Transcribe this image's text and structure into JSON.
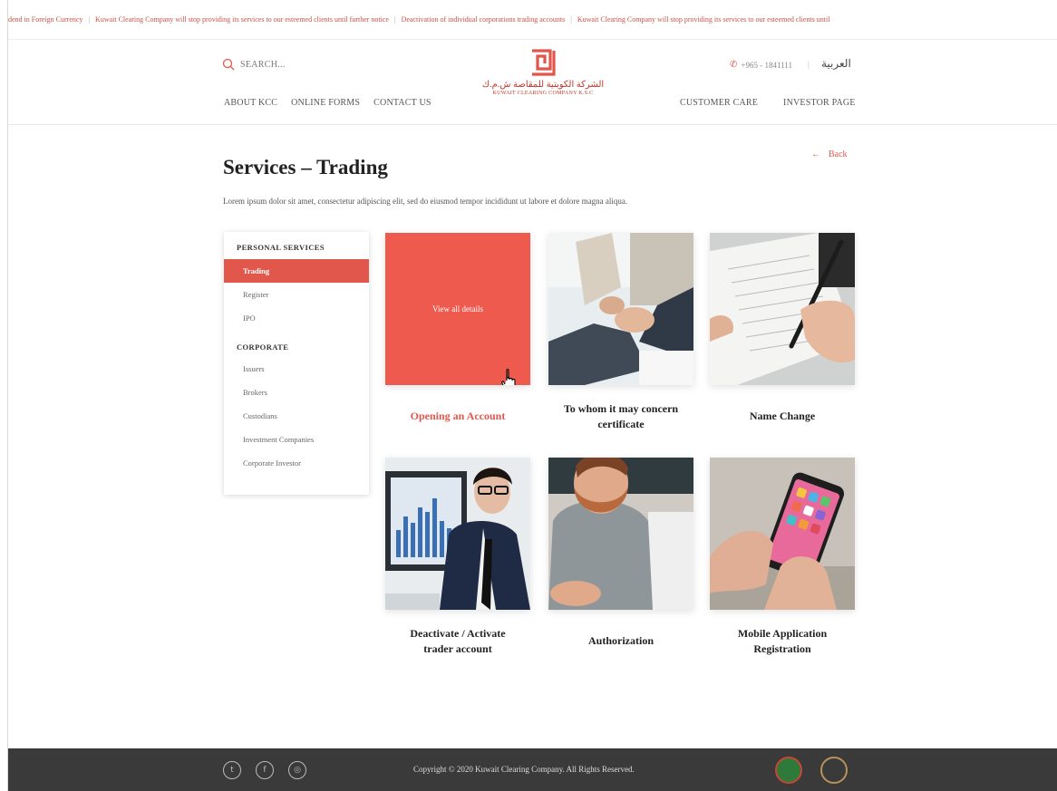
{
  "ticker": [
    "dend in Foreign Currency",
    "Kuwait Clearing Company will stop providing its services to our esteemed clients until further notice",
    "Deactivation of individual corporations trading accounts",
    "Kuwait Clearing Company will stop providing its services to our esteemed clients until"
  ],
  "ticker_sep": "|",
  "header": {
    "search_label": "SEARCH...",
    "phone": "+965 - 1841111",
    "separator": "|",
    "language": "العربية",
    "logo_arabic": "الشركة الكويتية للمقاصة ش.م.ك",
    "logo_english": "KUWAIT CLEARING COMPANY K.S.C",
    "nav_left": [
      "ABOUT KCC",
      "ONLINE FORMS",
      "CONTACT US"
    ],
    "nav_right": [
      "CUSTOMER CARE",
      "INVESTOR PAGE"
    ]
  },
  "page": {
    "back": "Back",
    "title": "Services – Trading",
    "description": "Lorem ipsum dolor sit amet, consectetur adipiscing elit, sed do eiusmod tempor incididunt ut labore et dolore magna aliqua."
  },
  "sidebar": {
    "personal_heading": "PERSONAL SERVICES",
    "personal_items": [
      "Trading",
      "Register",
      "IPO"
    ],
    "corporate_heading": "CORPORATE",
    "corporate_items": [
      "Issuers",
      "Brokers",
      "Custodians",
      "Investment Companies",
      "Corporate Investor"
    ]
  },
  "cards": [
    {
      "line1": "Opening an Account",
      "line2": "",
      "overlay": "View all details"
    },
    {
      "line1": "To whom it may concern",
      "line2": "certificate"
    },
    {
      "line1": "Name Change",
      "line2": ""
    },
    {
      "line1": "Deactivate / Activate",
      "line2": "trader account"
    },
    {
      "line1": "Authorization",
      "line2": ""
    },
    {
      "line1": "Mobile Application",
      "line2": "Registration"
    }
  ],
  "footer": {
    "copyright": "Copyright © 2020 Kuwait Clearing Company. All Rights Reserved."
  },
  "colors": {
    "accent": "#e2574c",
    "footer_bg": "#3a3a3a"
  },
  "icons": {
    "social": [
      "twitter-icon",
      "facebook-icon",
      "instagram-icon"
    ]
  }
}
